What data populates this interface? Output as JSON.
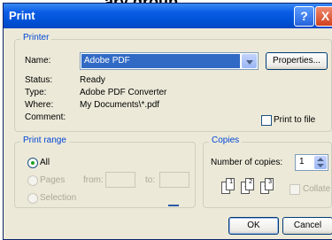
{
  "background_text": "ary group",
  "window": {
    "title": "Print",
    "help_label": "?",
    "close_label": "X"
  },
  "printer": {
    "legend": "Printer",
    "name_label": "Name:",
    "name_value": "Adobe PDF",
    "properties_label": "Properties...",
    "status_label": "Status:",
    "status_value": "Ready",
    "type_label": "Type:",
    "type_value": "Adobe PDF Converter",
    "where_label": "Where:",
    "where_value": "My Documents\\*.pdf",
    "comment_label": "Comment:",
    "print_to_file_label": "Print to file"
  },
  "print_range": {
    "legend": "Print range",
    "all_label": "All",
    "pages_label": "Pages",
    "from_label": "from:",
    "to_label": "to:",
    "selection_label": "Selection"
  },
  "copies": {
    "legend": "Copies",
    "number_label": "Number of copies:",
    "number_value": "1",
    "collate_label": "Collate",
    "page_numbers": [
      "1",
      "1",
      "2",
      "2",
      "3",
      "3"
    ]
  },
  "buttons": {
    "ok_label": "OK",
    "cancel_label": "Cancel"
  },
  "colors": {
    "title_bar": "#0a5ce6",
    "group_legend": "#0046d5",
    "selection": "#316ac5"
  }
}
